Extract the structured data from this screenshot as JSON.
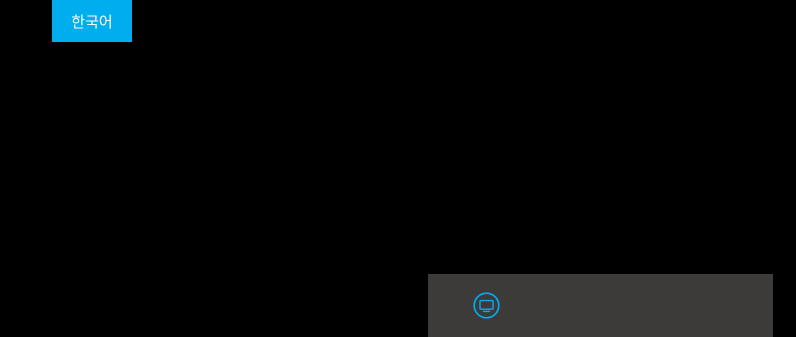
{
  "header": {
    "language_button_label": "한국어"
  },
  "bottom_panel": {
    "icon": "tv-icon"
  },
  "colors": {
    "background": "#000000",
    "accent": "#00adef",
    "panel": "#3d3a3a"
  }
}
